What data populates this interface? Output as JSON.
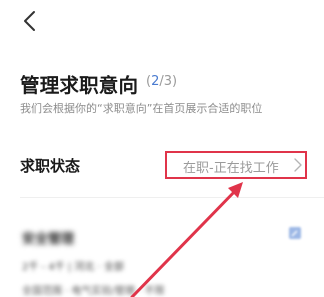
{
  "header": {
    "back_icon": "chevron-left-icon"
  },
  "page": {
    "title": "管理求职意向",
    "step_current": "2",
    "step_total": "/3",
    "step_open": "(",
    "step_close": ")",
    "subtitle": "我们会根据你的“求职意向”在首页展示合适的职位"
  },
  "job_status": {
    "label": "求职状态",
    "value": "在职-正在找工作",
    "chevron_icon": "chevron-right-icon"
  },
  "intention_card": {
    "title": "安全管理",
    "subtitle": "2千 - 4千 | 河北 · 全部",
    "footer": "全国范围 · 电气实验/管理 · 不限",
    "edit_icon": "edit-icon"
  },
  "annotation": {
    "highlight_color": "#e0344a"
  }
}
